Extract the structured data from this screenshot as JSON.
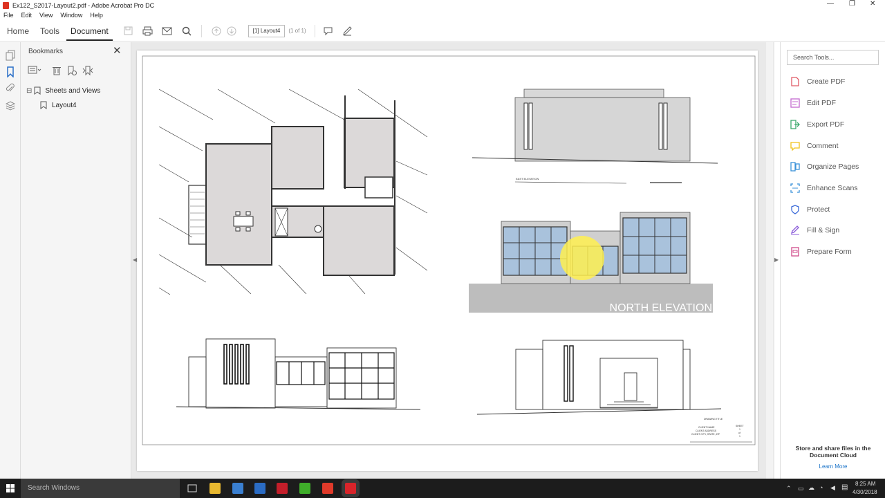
{
  "window": {
    "title": "Ex122_S2017-Layout2.pdf - Adobe Acrobat Pro DC",
    "controls": {
      "minimize": "—",
      "maximize": "❐",
      "close": "✕"
    }
  },
  "menu": [
    "File",
    "Edit",
    "View",
    "Window",
    "Help"
  ],
  "toolbar": {
    "tabs": [
      "Home",
      "Tools",
      "Document"
    ],
    "active_tab": "Document",
    "page_field": "[1] Layout4",
    "page_count": "(1 of 1)"
  },
  "bookmarks": {
    "title": "Bookmarks",
    "close": "✕",
    "tree": {
      "root": {
        "expander": "⊟",
        "label": "Sheets and Views"
      },
      "child": {
        "label": "Layout4"
      }
    }
  },
  "drawing": {
    "east_elevation_caption": "EAST ELEVATION",
    "north_elevation_label": "NORTH ELEVATION",
    "title_block": {
      "drawing_title": "DRAWING TITLE",
      "client_name": "CLIENT NAME",
      "client_address": "CLIENT ADDRESS",
      "client_city": "CLIENT CITY, STATE, ZIP",
      "sheet_label": "SHEET",
      "sheet_number": "1",
      "sheet_of": "of",
      "sheet_total": "1"
    }
  },
  "tools_panel": {
    "search_placeholder": "Search Tools...",
    "tools": [
      {
        "label": "Create PDF",
        "icon": "create-pdf-icon",
        "color": "#e05a66"
      },
      {
        "label": "Edit PDF",
        "icon": "edit-pdf-icon",
        "color": "#c46ad0"
      },
      {
        "label": "Export PDF",
        "icon": "export-pdf-icon",
        "color": "#3aa86b"
      },
      {
        "label": "Comment",
        "icon": "comment-icon",
        "color": "#f0c21c"
      },
      {
        "label": "Organize Pages",
        "icon": "organize-pages-icon",
        "color": "#3b92d9"
      },
      {
        "label": "Enhance Scans",
        "icon": "enhance-scans-icon",
        "color": "#3b92d9"
      },
      {
        "label": "Protect",
        "icon": "protect-icon",
        "color": "#3b6bd9"
      },
      {
        "label": "Fill & Sign",
        "icon": "fill-sign-icon",
        "color": "#8b5cd9"
      },
      {
        "label": "Prepare Form",
        "icon": "prepare-form-icon",
        "color": "#d04a8a"
      }
    ],
    "cloud_text": "Store and share files in the Document Cloud",
    "learn_more": "Learn More"
  },
  "taskbar": {
    "search": "Search Windows",
    "time": "8:25 AM",
    "date": "4/30/2018"
  }
}
